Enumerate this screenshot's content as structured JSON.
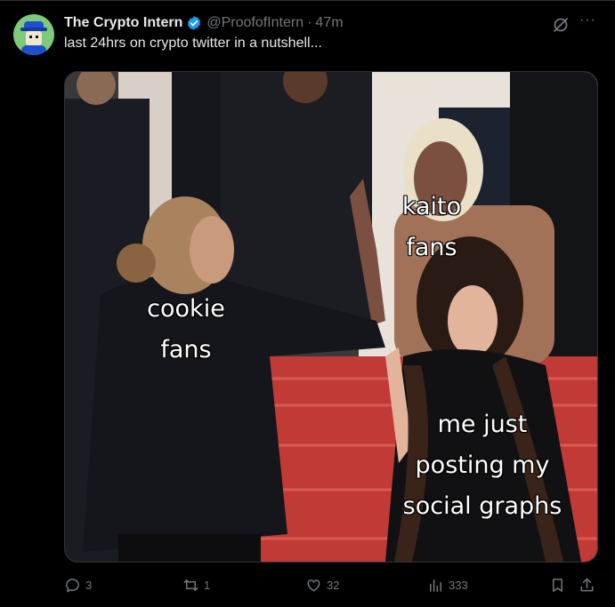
{
  "author": {
    "name": "The Crypto Intern",
    "handle": "@ProofofIntern",
    "time": "47m",
    "separator": "·"
  },
  "tweet": {
    "text": "last 24hrs on crypto twitter in a nutshell..."
  },
  "meme": {
    "left_label": [
      "cookie",
      "fans"
    ],
    "middle_label": [
      "kaito",
      "fans"
    ],
    "right_label": [
      "me just",
      "posting my",
      "social graphs"
    ]
  },
  "metrics": {
    "replies": "3",
    "reposts": "1",
    "likes": "32",
    "views": "333"
  },
  "colors": {
    "background": "#000000",
    "verified": "#1d9bf0",
    "muted": "#71767b",
    "carpet": "#c23a35"
  },
  "icons": [
    "grok-icon",
    "more-icon",
    "reply-icon",
    "repost-icon",
    "like-icon",
    "views-icon",
    "bookmark-icon",
    "share-icon",
    "verified-badge-icon"
  ]
}
